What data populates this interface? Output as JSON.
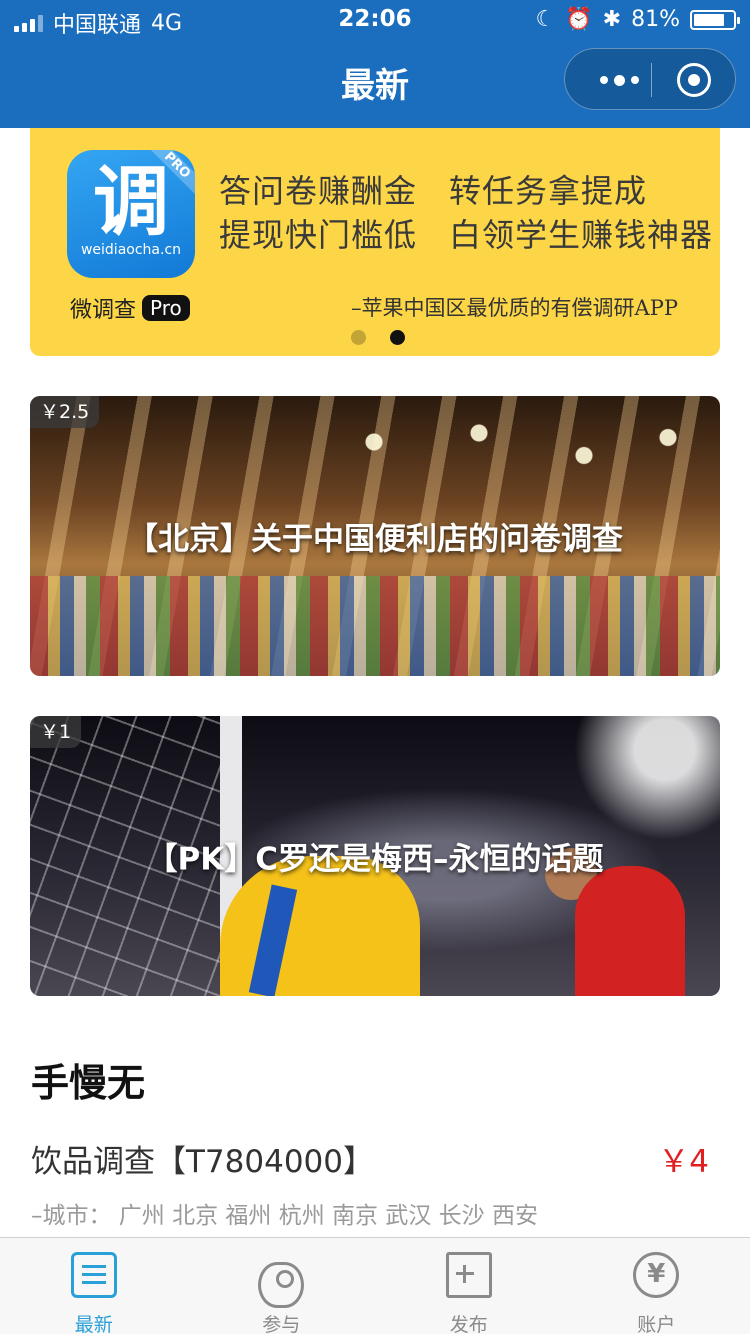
{
  "status": {
    "carrier": "中国联通",
    "network": "4G",
    "time": "22:06",
    "battery": "81%",
    "battery_level": 0.81
  },
  "nav": {
    "title": "最新"
  },
  "banner": {
    "icon_glyph": "调",
    "icon_domain": "weidiaocha.cn",
    "icon_ribbon": "PRO",
    "brand": "微调查",
    "brand_badge": "Pro",
    "lines": [
      "答问卷赚酬金",
      "转任务拿提成",
      "提现快门槛低",
      "白领学生赚钱神器"
    ],
    "tagline": "–苹果中国区最优质的有偿调研APP",
    "page_count": 2,
    "active_page": 2
  },
  "cards": [
    {
      "price": "￥2.5",
      "title": "【北京】关于中国便利店的问卷调查"
    },
    {
      "price": "￥1",
      "title": "【PK】C罗还是梅西–永恒的话题"
    }
  ],
  "section": {
    "title": "手慢无"
  },
  "item": {
    "name": "饮品调查【T7804000】",
    "price": "￥4",
    "cities": "–城市：  广州 北京 福州 杭州 南京 武汉 长沙 西安"
  },
  "tabs": [
    {
      "label": "最新",
      "icon": "list-icon",
      "active": true
    },
    {
      "label": "参与",
      "icon": "eye-icon",
      "active": false
    },
    {
      "label": "发布",
      "icon": "add-document-icon",
      "active": false
    },
    {
      "label": "账户",
      "icon": "yen-circle-icon",
      "active": false
    }
  ],
  "colors": {
    "nav_bg": "#1a6ebd",
    "banner_bg": "#fcd646",
    "price_red": "#e02020",
    "tab_active": "#2aa0d8"
  }
}
